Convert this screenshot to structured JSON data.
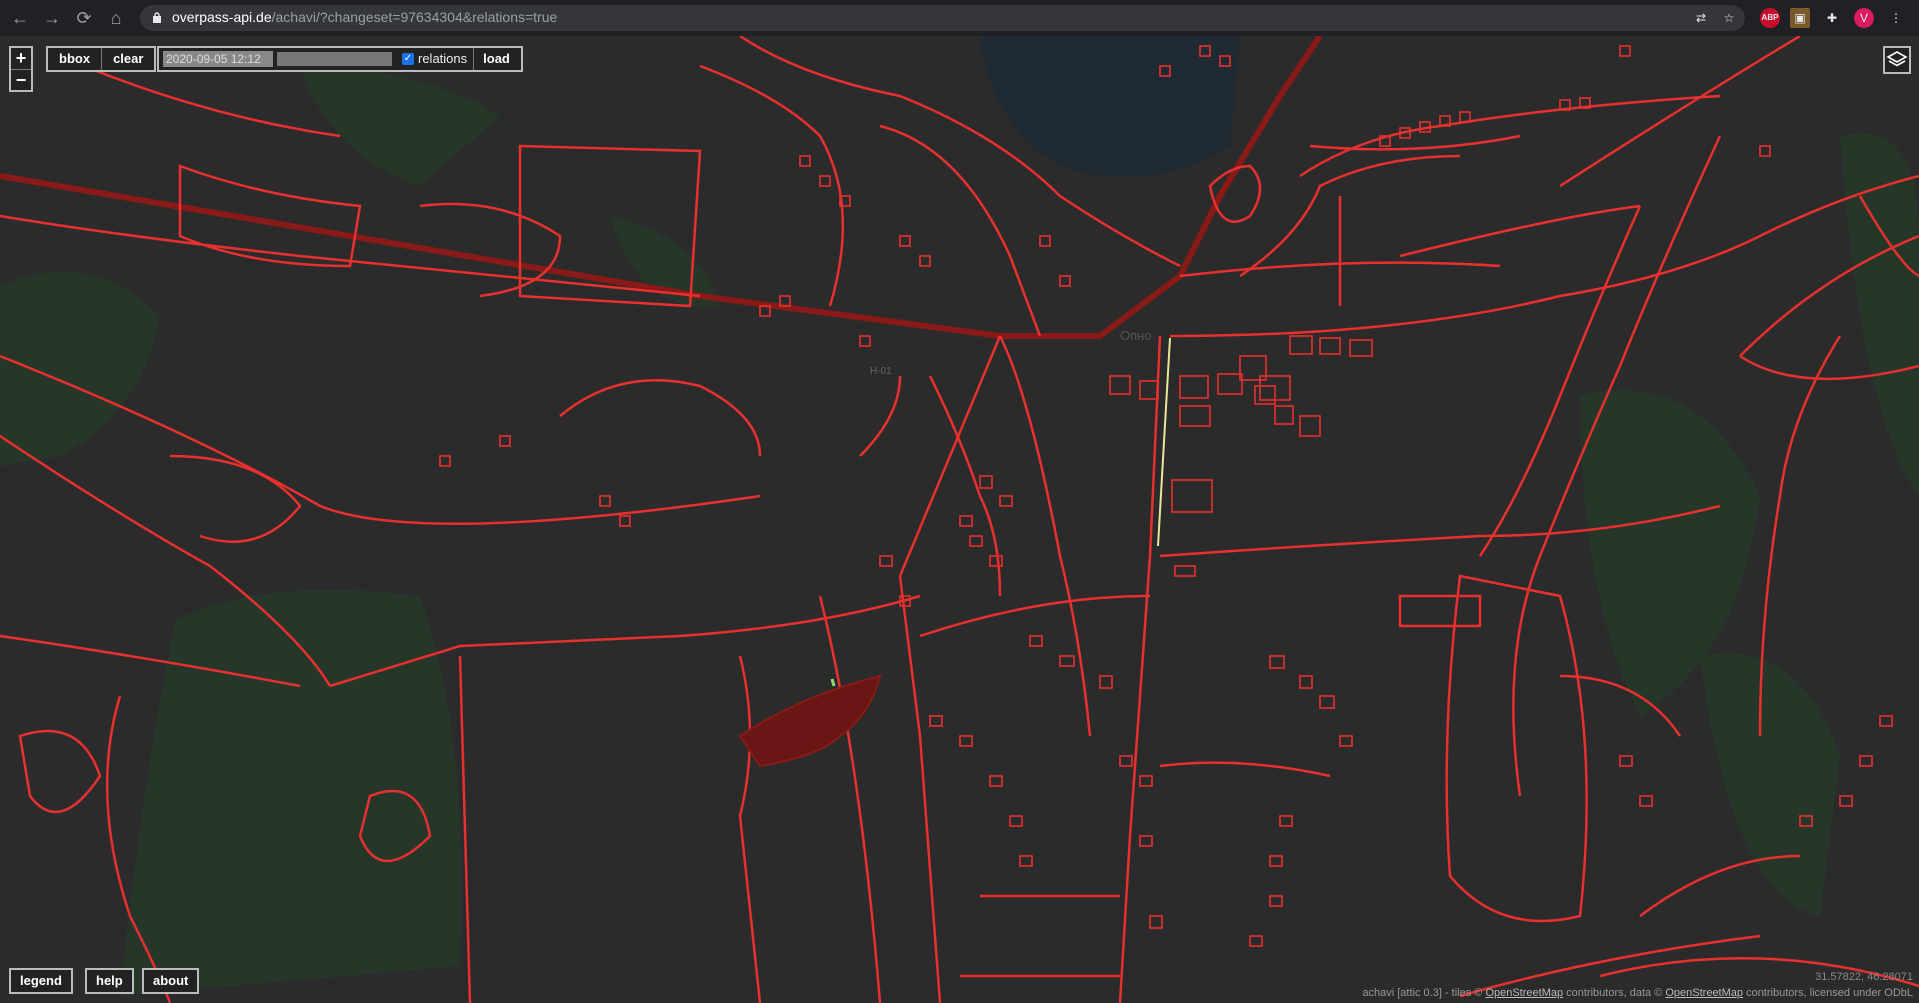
{
  "browser": {
    "url_host": "overpass-api.de",
    "url_rest": "/achavi/?changeset=97634304&relations=true",
    "avatar_letter": "V",
    "abp_label": "ABP"
  },
  "toolbar": {
    "zoom_in": "+",
    "zoom_out": "−",
    "bbox_label": "bbox",
    "clear_label": "clear",
    "date_value": "2020-09-05 12:12",
    "relations_label": "relations",
    "relations_checked": true,
    "load_label": "load"
  },
  "footer": {
    "legend_label": "legend",
    "help_label": "help",
    "about_label": "about",
    "coordinates": "31.57822, 46.28071",
    "attribution_prefix": "achavi [attic 0.3]  -  tiles © ",
    "attribution_osm1": "OpenStreetMap",
    "attribution_mid": " contributors, data © ",
    "attribution_osm2": "OpenStreetMap",
    "attribution_suffix": " contributors, licensed under ODbL"
  },
  "map": {
    "road_label": "Н-01",
    "place_label": "Опно",
    "colors": {
      "background": "#2b2b2b",
      "forest": "#263628",
      "water": "#1f2a33",
      "way": "#e8302f",
      "major_road": "#8a1a17",
      "highlight": "#e8e89a"
    }
  }
}
